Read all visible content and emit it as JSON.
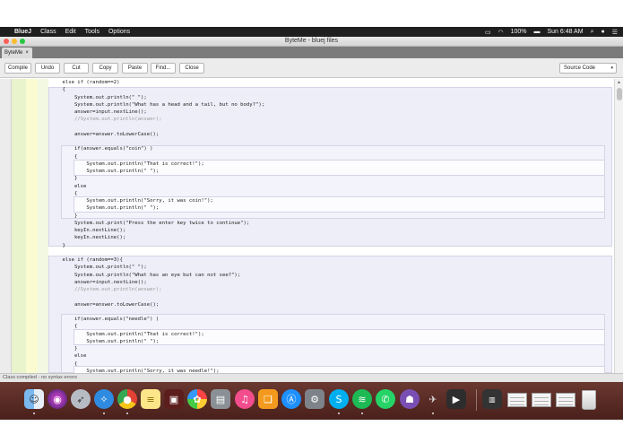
{
  "menubar": {
    "app": "BlueJ",
    "items": [
      "Class",
      "Edit",
      "Tools",
      "Options"
    ],
    "battery": "100%",
    "clock": "Sun 6:48 AM"
  },
  "window": {
    "title": "ByteMe - bluej files"
  },
  "tab": {
    "label": "ByteMe",
    "close": "×"
  },
  "toolbar": {
    "buttons": [
      "Compile",
      "Undo",
      "Cut",
      "Copy",
      "Paste",
      "Find...",
      "Close"
    ],
    "view_select": "Source Code"
  },
  "code": [
    "    else if (random==2)",
    "    {",
    "        System.out.println(\" \");",
    "        System.out.println(\"What has a head and a tail, but no body?\");",
    "        answer=input.nextLine();",
    "        //System.out.println(answer);",
    "",
    "        answer=answer.toLowerCase();",
    "",
    "        if(answer.equals(\"coin\") )",
    "        {",
    "            System.out.println(\"That is correct!\");",
    "            System.out.println(\" \");",
    "        }",
    "        else",
    "        {",
    "            System.out.println(\"Sorry, it was coin!\");",
    "            System.out.println(\" \");",
    "        }",
    "        System.out.print(\"Press the enter key twice to continue\");",
    "        keyIn.nextLine();",
    "        keyIn.nextLine();",
    "    }",
    "",
    "    else if (random==3){",
    "        System.out.println(\" \");",
    "        System.out.println(\"What has an eye but can not see?\");",
    "        answer=input.nextLine();",
    "        //System.out.println(answer);",
    "",
    "        answer=answer.toLowerCase();",
    "",
    "        if(answer.equals(\"needle\") )",
    "        {",
    "            System.out.println(\"That is correct!\");",
    "            System.out.println(\" \");",
    "        }",
    "        else",
    "        {",
    "            System.out.println(\"Sorry, it was needle!\");"
  ],
  "status": {
    "message": "Class compiled - no syntax errors"
  },
  "colors": {
    "menubar": "#1f1f1f",
    "dock": "#5a2a24",
    "scope_outer": "#eeeef9",
    "scope_inner": "#f3f3fb",
    "gutter_green": "#e9f3cc",
    "gutter_yellow": "#fbfbd2"
  },
  "dock": {
    "apps": [
      "finder-icon",
      "siri-icon",
      "launchpad-icon",
      "safari-icon",
      "chrome-icon",
      "notes-icon",
      "photo-booth-icon",
      "photos-icon",
      "image-capture-icon",
      "itunes-icon",
      "ibooks-icon",
      "app-store-icon",
      "system-preferences-icon",
      "skype-icon",
      "spotify-icon",
      "whatsapp-icon",
      "github-desktop-icon",
      "bluej-icon",
      "screencast-icon"
    ]
  }
}
